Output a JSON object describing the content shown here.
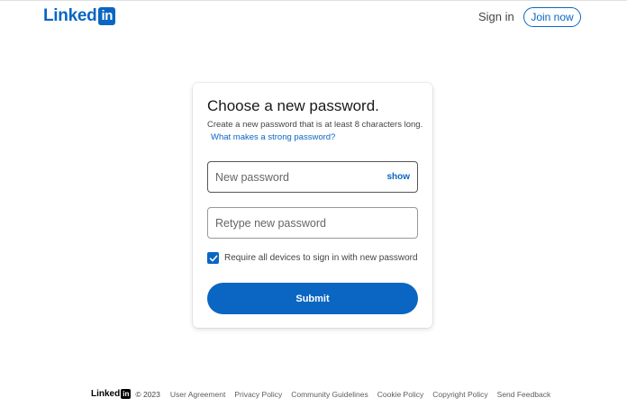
{
  "header": {
    "logo_text": "Linked",
    "logo_box": "in",
    "sign_in": "Sign in",
    "join_now": "Join now"
  },
  "card": {
    "title": "Choose a new password.",
    "subtitle": "Create a new password that is at least 8 characters long.",
    "help_link": "What makes a strong password?",
    "new_password_placeholder": "New password",
    "show_label": "show",
    "retype_placeholder": "Retype new password",
    "checkbox_label": "Require all devices to sign in with new password",
    "checkbox_checked": true,
    "submit_label": "Submit"
  },
  "footer": {
    "logo_text": "Linked",
    "logo_box": "in",
    "copyright": "© 2023",
    "links": [
      "User Agreement",
      "Privacy Policy",
      "Community Guidelines",
      "Cookie Policy",
      "Copyright Policy",
      "Send Feedback"
    ]
  },
  "colors": {
    "brand": "#0a66c2",
    "background": "#ffffff"
  }
}
